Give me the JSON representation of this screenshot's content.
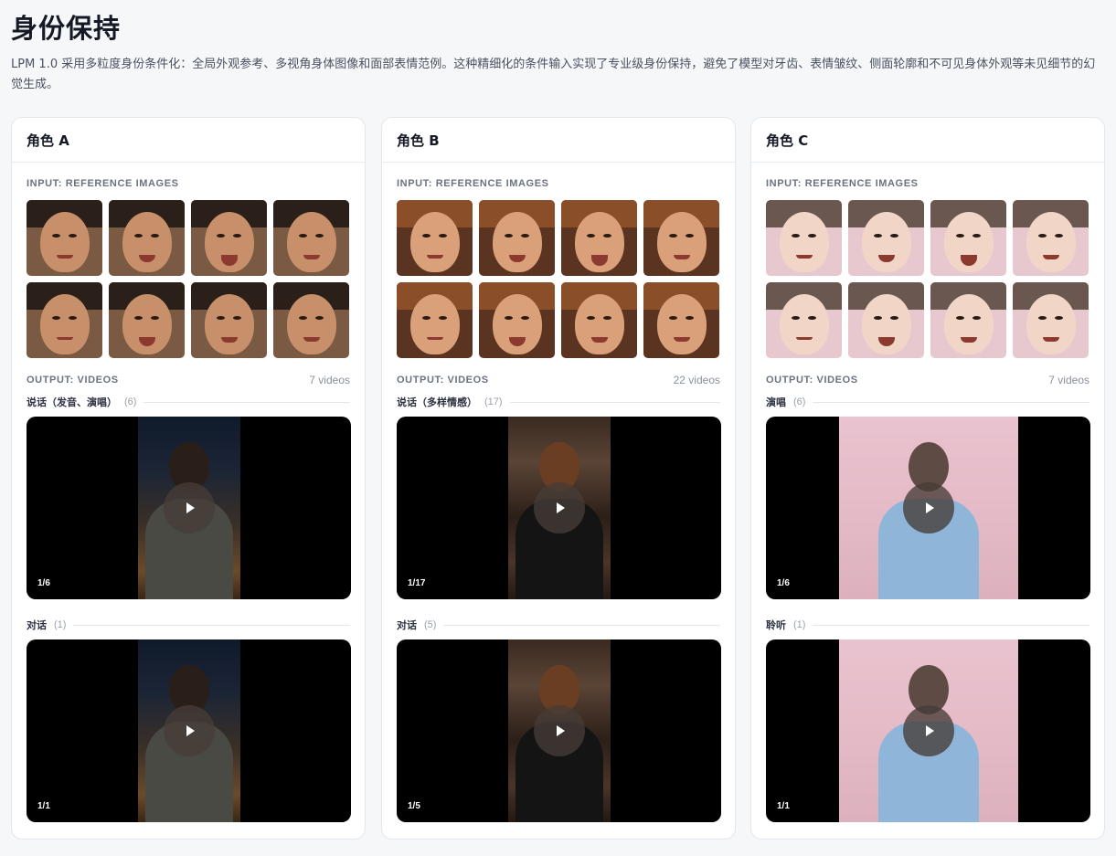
{
  "page": {
    "title": "身份保持",
    "description": "LPM 1.0 采用多粒度身份条件化：全局外观参考、多视角身体图像和面部表情范例。这种精细化的条件输入实现了专业级身份保持，避免了模型对牙齿、表情皱纹、侧面轮廓和不可见身体外观等未见细节的幻觉生成。"
  },
  "cards": [
    {
      "title": "角色 A",
      "input_label": "INPUT: REFERENCE IMAGES",
      "output_label": "OUTPUT: VIDEOS",
      "output_count": "7 videos",
      "thumb_palette": {
        "skin": "#c8906a",
        "hair": "#2b1f19",
        "bg": "#7a5a42"
      },
      "sections": [
        {
          "title": "说话（发音、演唱）",
          "count": "(6)",
          "video": {
            "counter": "1/6",
            "scene": "night-bar"
          }
        },
        {
          "title": "对话",
          "count": "(1)",
          "video": {
            "counter": "1/1",
            "scene": "night-bar"
          }
        }
      ]
    },
    {
      "title": "角色 B",
      "input_label": "INPUT: REFERENCE IMAGES",
      "output_label": "OUTPUT: VIDEOS",
      "output_count": "22 videos",
      "thumb_palette": {
        "skin": "#d9a07a",
        "hair": "#8a4e28",
        "bg": "#5a3420"
      },
      "sections": [
        {
          "title": "说话（多样情感）",
          "count": "(17)",
          "video": {
            "counter": "1/17",
            "scene": "piano-room"
          }
        },
        {
          "title": "对话",
          "count": "(5)",
          "video": {
            "counter": "1/5",
            "scene": "piano-room"
          }
        }
      ]
    },
    {
      "title": "角色 C",
      "input_label": "INPUT: REFERENCE IMAGES",
      "output_label": "OUTPUT: VIDEOS",
      "output_count": "7 videos",
      "thumb_palette": {
        "skin": "#f1d6c8",
        "hair": "#6a5850",
        "bg": "#e8c8cf"
      },
      "sections": [
        {
          "title": "演唱",
          "count": "(6)",
          "video": {
            "counter": "1/6",
            "scene": "pink-studio"
          }
        },
        {
          "title": "聆听",
          "count": "(1)",
          "video": {
            "counter": "1/1",
            "scene": "pink-studio"
          }
        }
      ]
    }
  ]
}
